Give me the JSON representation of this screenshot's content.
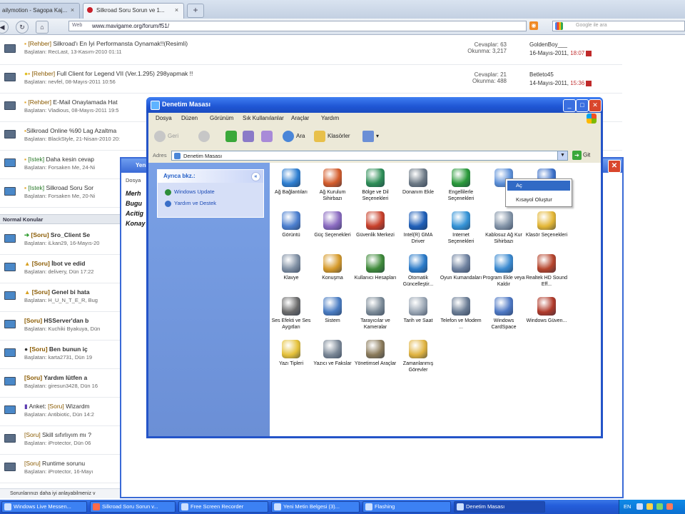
{
  "browser": {
    "tabs": [
      {
        "label": "ailymotion - Sagopa Kaj..."
      },
      {
        "label": "Silkroad Soru Sorun ve 1..."
      }
    ],
    "new_tab": "+",
    "address_prefix": "Web",
    "url": "www.mavigame.org/forum/f51/",
    "search_placeholder": "Google ile ara"
  },
  "forum": {
    "rows": [
      {
        "tag": "[Rehber]",
        "title": " Silkroad'ı En İyi Performansta Oynamak!!(Resimli)",
        "by": "Başlatan: RecLast, 13-Kasım-2010 01:11",
        "stats": "Cevaplar: 63\nOkunma: 3,217",
        "last_user": "GoldenBoy___",
        "last_date": "16-Mayıs-2011, ",
        "last_time": "18:07"
      },
      {
        "tag": "[Rehber]",
        "title": " Full Client for Legend VII (Ver.1.295) 298yapmak !!",
        "by": "Başlatan: nevfel, 08-Mayıs-2011 10:56",
        "stats": "Cevaplar: 21\nOkunma: 488",
        "last_user": "Betleto45",
        "last_date": "14-Mayıs-2011, ",
        "last_time": "15:36"
      },
      {
        "tag": "[Rehber]",
        "title": " E-Mail Onaylamada Hat",
        "by": "Başlatan: Vladious, 08-Mayıs-2011 19:5"
      },
      {
        "tag": "",
        "title": "Silkroad Online %90 Lag Azaltma",
        "by": "Başlatan: BlackStyle, 21-Nisan-2010 20:"
      },
      {
        "tag": "[Istek]",
        "title": " Daha kesin cevap",
        "by": "Başlatan: Forsaken Me, 24-Ni"
      },
      {
        "tag": "[Istek]",
        "title": " Silkroad Soru Sor",
        "by": "Başlatan: Forsaken Me, 20-Ni"
      }
    ],
    "section_label": "Normal Konular",
    "normal_rows": [
      {
        "tag": "[Soru]",
        "title": " Sro_Client Se",
        "by": "Başlatan: iLkan29, 16-Mayıs-20"
      },
      {
        "tag": "[Soru]",
        "title": " İbot ve edid",
        "by": "Başlatan: delivery, Dün 17:22"
      },
      {
        "tag": "[Soru]",
        "title": " Genel bi hata",
        "by": "Başlatan: H_U_N_T_E_R, Bug"
      },
      {
        "tag": "[Soru]",
        "title": " HSServer'dan b",
        "by": "Başlatan: Kuchiki Byakuya, Dün"
      },
      {
        "tag": "[Soru]",
        "title": " Ben bunun iç",
        "by": "Başlatan: karta2731, Dün 19"
      },
      {
        "tag": "[Soru]",
        "title": " Yardım lütfen a",
        "by": "Başlatan: giresun3428, Dün 16"
      },
      {
        "tag": "[Soru]",
        "title": " Wizardm",
        "prefix": "Anket: ",
        "by": "Başlatan: Antibiotic, Dün 14:2"
      },
      {
        "tag": "[Soru]",
        "title": " Skill sıfırlıyım mı ?",
        "by": "Başlatan: iProtector, Dün 06"
      },
      {
        "tag": "[Soru]",
        "title": " Runtime sorunu",
        "by": "Başlatan: iProtector, 16-Mayı"
      }
    ],
    "bottom_status": "Sorunlarınızı daha iyi anlayabilmeniz v"
  },
  "notepad": {
    "title": "Yeni",
    "menu_label": "Dosya",
    "lines": [
      "Merh",
      "Bugu",
      "Acitig",
      "Konay"
    ]
  },
  "control_panel": {
    "title": "Denetim Masası",
    "menu": [
      "Dosya",
      "Düzen",
      "Görünüm",
      "Sık Kullanılanlar",
      "Araçlar",
      "Yardım"
    ],
    "toolbar": {
      "back": "Geri",
      "search": "Ara",
      "folders": "Klasörler"
    },
    "address_label": "Adres",
    "address_value": "Denetim Masası",
    "go_label": "Git",
    "side_heading": "Ayrıca bkz.:",
    "side_links": [
      "Windows Update",
      "Yardım ve Destek"
    ],
    "items": [
      {
        "label": "Ağ Bağlantıları",
        "icon": "network-icon",
        "color": "#2f7fd1"
      },
      {
        "label": "Ağ Kurulum Sihirbazı",
        "icon": "house-icon",
        "color": "#d35b2a"
      },
      {
        "label": "Bölge ve Dil Seçenekleri",
        "icon": "globe-icon",
        "color": "#2e8e57"
      },
      {
        "label": "Donanım Ekle",
        "icon": "hardware-icon",
        "color": "#6d7a86"
      },
      {
        "label": "Engellilerle Seçenekleri",
        "icon": "accessibility-icon",
        "color": "#2a9a3a"
      },
      {
        "label": "",
        "icon": "mouse-icon",
        "color": "#5b8fd8"
      },
      {
        "label": "",
        "icon": "monitor-icon",
        "color": "#3a6fc8"
      },
      {
        "label": "Görüntü",
        "icon": "display-icon",
        "color": "#4c7fcf"
      },
      {
        "label": "Güç Seçenekleri",
        "icon": "power-icon",
        "color": "#8a6ac0"
      },
      {
        "label": "Güvenlik Merkezi",
        "icon": "shield-icon",
        "color": "#c8402a"
      },
      {
        "label": "Intel(R) GMA Driver",
        "icon": "intel-icon",
        "color": "#1f5fb8"
      },
      {
        "label": "Internet Seçenekleri",
        "icon": "internet-icon",
        "color": "#3593d6"
      },
      {
        "label": "Kablosuz Ağ Kur Sihirbazı",
        "icon": "wireless-icon",
        "color": "#8394a8"
      },
      {
        "label": "Klasör Seçenekleri",
        "icon": "folder-options-icon",
        "color": "#e3b635"
      },
      {
        "label": "Klavye",
        "icon": "keyboard-icon",
        "color": "#7f8fa3"
      },
      {
        "label": "Konuşma",
        "icon": "speech-icon",
        "color": "#d69a2a"
      },
      {
        "label": "Kullanıcı Hesapları",
        "icon": "users-icon",
        "color": "#3f8a3a"
      },
      {
        "label": "Otomatik Güncelleştir...",
        "icon": "update-icon",
        "color": "#2a7ac8"
      },
      {
        "label": "Oyun Kumandaları",
        "icon": "gamepad-icon",
        "color": "#6f82a0"
      },
      {
        "label": "Program Ekle veya Kaldır",
        "icon": "programs-icon",
        "color": "#3b8ad0"
      },
      {
        "label": "Realtek HD Sound Eff...",
        "icon": "speaker-icon",
        "color": "#b5442c"
      },
      {
        "label": "Ses Efekti ve Ses Aygıtları",
        "icon": "sound-icon",
        "color": "#6b6b6b"
      },
      {
        "label": "Sistem",
        "icon": "system-icon",
        "color": "#4a7cc2"
      },
      {
        "label": "Tarayıcılar ve Kameralar",
        "icon": "scanner-icon",
        "color": "#7c8b98"
      },
      {
        "label": "Tarih ve Saat",
        "icon": "clock-icon",
        "color": "#9aa6b4"
      },
      {
        "label": "Telefon ve Modem ...",
        "icon": "phone-icon",
        "color": "#6b7d95"
      },
      {
        "label": "Windows CardSpace",
        "icon": "cardspace-icon",
        "color": "#4e78c4"
      },
      {
        "label": "Windows Güven...",
        "icon": "firewall-icon",
        "color": "#b03a2a"
      },
      {
        "label": "Yazı Tipleri",
        "icon": "fonts-icon",
        "color": "#e5c13a"
      },
      {
        "label": "Yazıcı ve Fakslar",
        "icon": "printer-icon",
        "color": "#7a8796"
      },
      {
        "label": "Yönetimsel Araçlar",
        "icon": "admin-tools-icon",
        "color": "#8a7a5a"
      },
      {
        "label": "Zamanlanmış Görevler",
        "icon": "tasks-icon",
        "color": "#e0b340"
      }
    ],
    "context_menu": [
      "Aç",
      "Kısayol Oluştur"
    ]
  },
  "taskbar": {
    "items": [
      "Windows Live Messen...",
      "Silkroad Soru Sorun v...",
      "Free Screen Recorder",
      "Yeni Metin Belgesi (3)...",
      "Flashing",
      "Denetim Masası"
    ],
    "tray_lang": "EN"
  },
  "colors": {
    "xp_blue": "#2454c8",
    "taskbar": "#245edb",
    "sidebar": "#7aa1e6",
    "selection": "#316ac5"
  }
}
